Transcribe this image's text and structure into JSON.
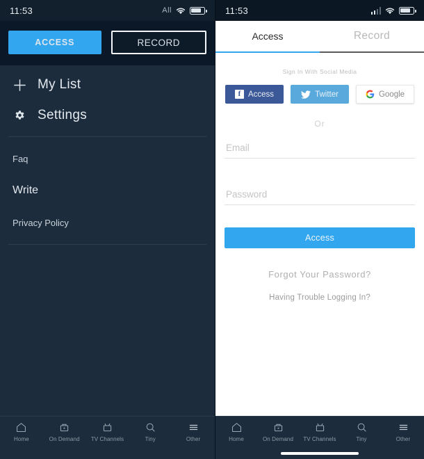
{
  "left_panel": {
    "status": {
      "time": "11:53",
      "signal_label": "All",
      "wifi_icon": "wifi-icon",
      "battery_icon": "battery-icon"
    },
    "header": {
      "access_label": "ACCESS",
      "record_label": "RECORD"
    },
    "menu": [
      {
        "label": "My List",
        "icon": "plus-icon"
      },
      {
        "label": "Settings",
        "icon": "gear-icon"
      }
    ],
    "links": [
      {
        "label": "Faq"
      },
      {
        "label": "Write"
      },
      {
        "label": "Privacy Policy"
      }
    ]
  },
  "right_panel": {
    "status": {
      "time": "11:53",
      "signal_icon": "signal-bars-icon",
      "wifi_icon": "wifi-icon",
      "battery_icon": "battery-icon"
    },
    "tabs": [
      {
        "label": "Access",
        "active": true
      },
      {
        "label": "Record",
        "active": false
      }
    ],
    "social_title": "Sign In With Social Media",
    "social_buttons": [
      {
        "label": "Access",
        "icon": "facebook-icon"
      },
      {
        "label": "Twitter",
        "icon": "twitter-icon"
      },
      {
        "label": "Google",
        "icon": "google-icon"
      }
    ],
    "or_label": "Or",
    "email": {
      "placeholder": "Email",
      "value": ""
    },
    "password": {
      "placeholder": "Password",
      "value": ""
    },
    "submit_label": "Access",
    "forgot_label": "Forgot Your Password?",
    "trouble_label": "Having Trouble Logging In?"
  },
  "bottom_nav": [
    {
      "label": "Home",
      "icon": "home-icon"
    },
    {
      "label": "On Demand",
      "icon": "on-demand-icon"
    },
    {
      "label": "TV Channels",
      "icon": "tv-icon"
    },
    {
      "label": "Tiny",
      "icon": "search-icon"
    },
    {
      "label": "Other",
      "icon": "menu-icon"
    }
  ],
  "colors": {
    "accent": "#33a6f0",
    "drawer_bg": "#1d2c3c",
    "drawer_header_bg": "#0a1828",
    "facebook": "#3b5998",
    "twitter": "#5aa9dd"
  }
}
